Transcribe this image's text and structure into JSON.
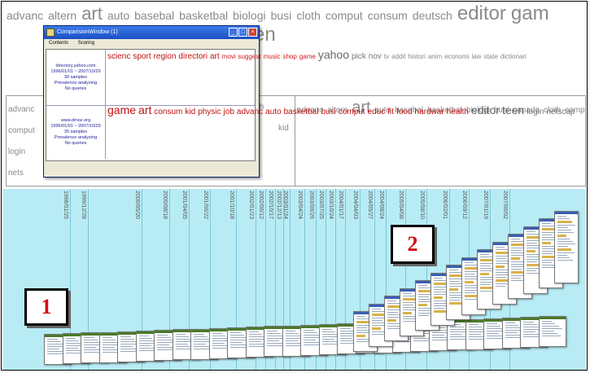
{
  "top_cloud": [
    {
      "w": "advanc",
      "s": "s"
    },
    {
      "w": "altern",
      "s": "s"
    },
    {
      "w": "art",
      "s": "l"
    },
    {
      "w": "auto",
      "s": "s"
    },
    {
      "w": "basebal",
      "s": "s"
    },
    {
      "w": "basketbal",
      "s": "s"
    },
    {
      "w": "biologi",
      "s": "s"
    },
    {
      "w": "busi",
      "s": "s"
    },
    {
      "w": "cloth",
      "s": "s"
    },
    {
      "w": "comput",
      "s": "s"
    },
    {
      "w": "consum",
      "s": "s"
    },
    {
      "w": "deutsch",
      "s": "s"
    },
    {
      "w": "editor",
      "s": "xl"
    },
    {
      "w": "gam",
      "s": "xl"
    }
  ],
  "top_cloud_trailing": "en",
  "left_panel_words": [
    "advanc",
    "comput",
    "login",
    "nets"
  ],
  "left_panel_fragments": [
    "th",
    "e",
    "kid"
  ],
  "right_panel": [
    {
      "w": "advanc",
      "s": "s"
    },
    {
      "w": "altern",
      "s": "s"
    },
    {
      "w": "art",
      "s": "big"
    },
    {
      "w": "auto",
      "s": "s"
    },
    {
      "w": "basebal",
      "s": "s"
    },
    {
      "w": "basketbal",
      "s": "s"
    },
    {
      "w": "biologi",
      "s": "s"
    },
    {
      "w": "busi",
      "s": "s"
    },
    {
      "w": "canada",
      "s": "s"
    },
    {
      "w": "cloth",
      "s": "s"
    },
    {
      "w": "comput",
      "s": "s"
    },
    {
      "w": "consum",
      "s": "s"
    },
    {
      "w": "deutsch",
      "s": "s"
    },
    {
      "w": "editor",
      "s": "big"
    },
    {
      "w": "game",
      "s": "big"
    },
    {
      "w": "kid",
      "s": "s"
    },
    {
      "w": "login",
      "s": "s"
    },
    {
      "w": "netscap",
      "s": "s"
    },
    {
      "w": "shop",
      "s": "s"
    },
    {
      "w": "teen",
      "s": "big"
    }
  ],
  "comparison_window": {
    "title": "ComparisionWindow (1)",
    "menu": [
      "Contents",
      "Scoring"
    ],
    "rows": [
      {
        "meta": [
          "directory.yahoo.com",
          "1996/01/01 ~ 2007/10/29",
          "30 samples",
          "Prevalence analyzing",
          "No queries"
        ],
        "tags": [
          {
            "w": "scienc",
            "c": "red-m"
          },
          {
            "w": "sport",
            "c": "red-m"
          },
          {
            "w": "region",
            "c": "red-m"
          },
          {
            "w": "directori",
            "c": "red-m"
          },
          {
            "w": "art",
            "c": "red-m"
          },
          {
            "w": "movi",
            "c": "red-s"
          },
          {
            "w": "suggest",
            "c": "red-s"
          },
          {
            "w": "music",
            "c": "red-s"
          },
          {
            "w": "shop",
            "c": "red-s"
          },
          {
            "w": "game",
            "c": "red-s"
          },
          {
            "w": "yahoo",
            "c": "gray-l"
          },
          {
            "w": "pick",
            "c": "gray-m"
          },
          {
            "w": "nov",
            "c": "gray-m"
          },
          {
            "w": "tv",
            "c": "gray-s"
          },
          {
            "w": "addit",
            "c": "gray-s"
          },
          {
            "w": "histori",
            "c": "gray-s"
          },
          {
            "w": "anim",
            "c": "gray-s"
          },
          {
            "w": "economi",
            "c": "gray-s"
          },
          {
            "w": "law",
            "c": "gray-s"
          },
          {
            "w": "state",
            "c": "gray-s"
          },
          {
            "w": "dictionari",
            "c": "gray-s"
          }
        ]
      },
      {
        "meta": [
          "www.dmoz.org",
          "1996/01/01 ~ 2007/10/29",
          "30 samples",
          "Prevalence analyzing",
          "No queries"
        ],
        "tags": [
          {
            "w": "game",
            "c": "red-l"
          },
          {
            "w": "art",
            "c": "red-l"
          },
          {
            "w": "consum",
            "c": "red-m"
          },
          {
            "w": "kid",
            "c": "red-m"
          },
          {
            "w": "physic",
            "c": "red-m"
          },
          {
            "w": "job",
            "c": "red-m"
          },
          {
            "w": "advanc",
            "c": "red-m"
          },
          {
            "w": "auto",
            "c": "red-m"
          },
          {
            "w": "basketbal",
            "c": "red-m"
          },
          {
            "w": "busi",
            "c": "red-m"
          },
          {
            "w": "comput",
            "c": "red-m"
          },
          {
            "w": "educ",
            "c": "red-m"
          },
          {
            "w": "fit",
            "c": "red-m"
          },
          {
            "w": "food",
            "c": "red-m"
          },
          {
            "w": "hardwar",
            "c": "red-m"
          },
          {
            "w": "health",
            "c": "red-m"
          },
          {
            "w": "editor",
            "c": "gray-l"
          },
          {
            "w": "teen",
            "c": "gray-l"
          },
          {
            "w": "login",
            "c": "gray-m"
          },
          {
            "w": "netscap",
            "c": "gray-m"
          }
        ]
      }
    ]
  },
  "timeline_dates": [
    "1998/01/25",
    "1999/12/28",
    "2000/05/20",
    "2000/08/18",
    "2001/04/05",
    "2001/06/22",
    "2001/10/18",
    "2002/01/23",
    "2002/06/12",
    "2002/10/17",
    "2002/12/13",
    "2003/01/24",
    "2003/04/24",
    "2003/06/26",
    "2003/07/25",
    "2003/10/24",
    "2004/01/17",
    "2004/04/03",
    "2004/05/27",
    "2004/08/24",
    "2005/04/08",
    "2005/08/10",
    "2006/02/01",
    "2006/09/12",
    "2007/01/19",
    "2007/06/02"
  ],
  "markers": {
    "one": "1",
    "two": "2"
  }
}
